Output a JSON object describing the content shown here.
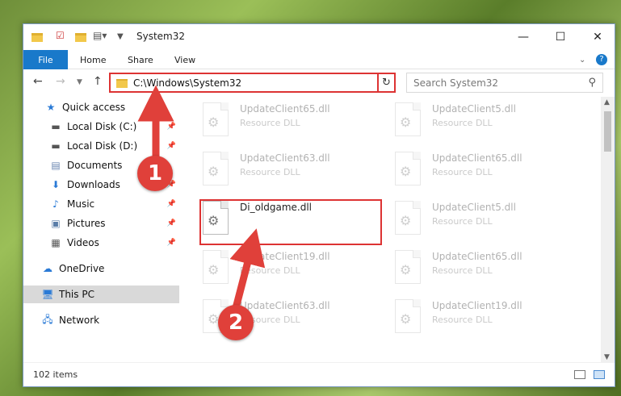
{
  "window": {
    "title": "System32"
  },
  "ribbon": {
    "file": "File",
    "home": "Home",
    "share": "Share",
    "view": "View"
  },
  "address": {
    "path": "C:\\Windows\\System32"
  },
  "search": {
    "placeholder": "Search System32"
  },
  "sidebar": {
    "items": [
      {
        "label": "Quick access",
        "icon": "star-icon"
      },
      {
        "label": "Local Disk (C:)",
        "icon": "drive-icon"
      },
      {
        "label": "Local Disk (D:)",
        "icon": "drive-icon"
      },
      {
        "label": "Documents",
        "icon": "documents-icon"
      },
      {
        "label": "Downloads",
        "icon": "download-icon"
      },
      {
        "label": "Music",
        "icon": "music-icon"
      },
      {
        "label": "Pictures",
        "icon": "pictures-icon"
      },
      {
        "label": "Videos",
        "icon": "videos-icon"
      },
      {
        "label": "OneDrive",
        "icon": "cloud-icon"
      },
      {
        "label": "This PC",
        "icon": "computer-icon"
      },
      {
        "label": "Network",
        "icon": "network-icon"
      }
    ]
  },
  "files": {
    "left": [
      {
        "name": "UpdateClient65.dll",
        "type": "Resource DLL"
      },
      {
        "name": "UpdateClient63.dll",
        "type": "Resource DLL"
      },
      {
        "name": "Di_oldgame.dll",
        "type": ""
      },
      {
        "name": "UpdateClient19.dll",
        "type": "Resource DLL"
      },
      {
        "name": "UpdateClient63.dll",
        "type": "Resource DLL"
      }
    ],
    "right": [
      {
        "name": "UpdateClient5.dll",
        "type": "Resource DLL"
      },
      {
        "name": "UpdateClient65.dll",
        "type": "Resource DLL"
      },
      {
        "name": "UpdateClient5.dll",
        "type": "Resource DLL"
      },
      {
        "name": "UpdateClient65.dll",
        "type": "Resource DLL"
      },
      {
        "name": "UpdateClient19.dll",
        "type": "Resource DLL"
      }
    ]
  },
  "status": {
    "count": "102 items"
  },
  "markers": {
    "one": "1",
    "two": "2"
  },
  "colors": {
    "accent": "#1979ca",
    "annotation": "#e0403a"
  }
}
